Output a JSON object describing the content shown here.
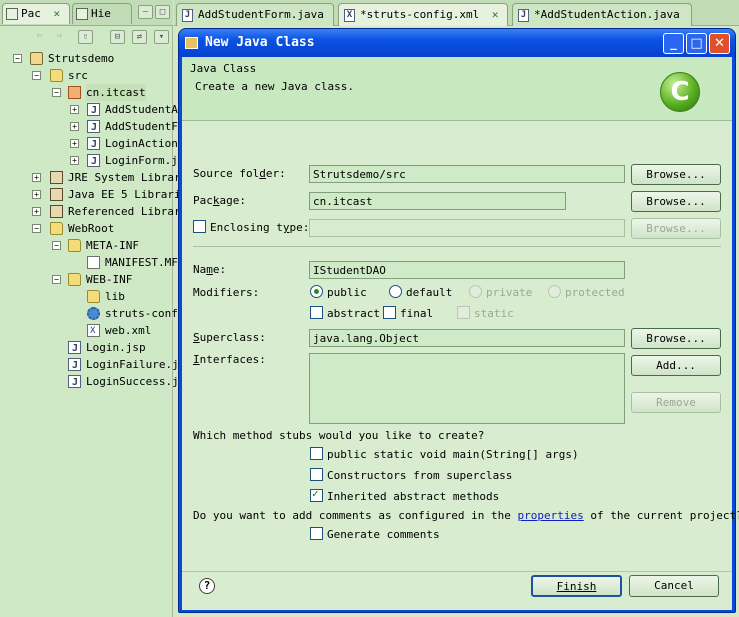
{
  "left_panel": {
    "tabs": [
      {
        "label": "Pac"
      },
      {
        "label": "Hie"
      }
    ],
    "tree": [
      {
        "label": "Strutsdemo",
        "icon": "project-icon"
      },
      {
        "label": "src",
        "icon": "source-folder-icon"
      },
      {
        "label": "cn.itcast",
        "icon": "package-icon"
      },
      {
        "label": "AddStudentA",
        "icon": "java-file-icon"
      },
      {
        "label": "AddStudentF",
        "icon": "java-file-icon"
      },
      {
        "label": "LoginAction",
        "icon": "java-file-icon"
      },
      {
        "label": "LoginForm.j",
        "icon": "java-file-icon"
      },
      {
        "label": "JRE System Librar",
        "icon": "library-icon"
      },
      {
        "label": "Java EE 5 Librari",
        "icon": "library-icon"
      },
      {
        "label": "Referenced Librar",
        "icon": "library-icon"
      },
      {
        "label": "WebRoot",
        "icon": "folder-icon"
      },
      {
        "label": "META-INF",
        "icon": "folder-icon"
      },
      {
        "label": "MANIFEST.MF",
        "icon": "file-icon"
      },
      {
        "label": "WEB-INF",
        "icon": "folder-icon"
      },
      {
        "label": "lib",
        "icon": "folder-icon"
      },
      {
        "label": "struts-conf",
        "icon": "gear-icon"
      },
      {
        "label": "web.xml",
        "icon": "xml-file-icon"
      },
      {
        "label": "Login.jsp",
        "icon": "jsp-file-icon"
      },
      {
        "label": "LoginFailure.j",
        "icon": "jsp-file-icon"
      },
      {
        "label": "LoginSuccess.j",
        "icon": "jsp-file-icon"
      }
    ]
  },
  "editor_tabs": [
    {
      "label": "AddStudentForm.java"
    },
    {
      "label": "*struts-config.xml"
    },
    {
      "label": "*AddStudentAction.java"
    }
  ],
  "dialog": {
    "title": "New Java Class",
    "header_title": "Java Class",
    "header_desc": "Create a new Java class.",
    "logo_letter": "C",
    "source_folder": {
      "label_a": "Source fol",
      "label_u": "d",
      "label_b": "er:",
      "value": "Strutsdemo/src",
      "button": "Browse..."
    },
    "package": {
      "label_a": "Pac",
      "label_u": "k",
      "label_b": "age:",
      "value": "cn.itcast",
      "button": "Browse..."
    },
    "enclosing": {
      "label_a": "Enclosing t",
      "label_u": "y",
      "label_b": "pe:",
      "value": "",
      "button": "Browse..."
    },
    "name": {
      "label_a": "Na",
      "label_u": "m",
      "label_b": "e:",
      "value": "IStudentDAO"
    },
    "modifiers": {
      "label": "Modifiers:",
      "public": "public",
      "default": "default",
      "private": "private",
      "protected": "protected",
      "abstract": "abstract",
      "final": "final",
      "static": "static"
    },
    "superclass": {
      "label_u": "S",
      "label_b": "uperclass:",
      "value": "java.lang.Object",
      "button": "Browse..."
    },
    "interfaces": {
      "label_u": "I",
      "label_b": "nterfaces:",
      "add": "Add...",
      "remove": "Remove"
    },
    "stubs_question": "Which method stubs would you like to create?",
    "stub_main": "public static void main(String[] args)",
    "stub_constructors": "Constructors from superclass",
    "stub_inherited": "Inherited abstract methods",
    "comments_q_a": "Do you want to add comments as configured in the ",
    "comments_link": "properties",
    "comments_q_b": " of the current project?",
    "generate_comments": "Generate comments",
    "finish": "Finish",
    "cancel": "Cancel",
    "help": "?"
  }
}
